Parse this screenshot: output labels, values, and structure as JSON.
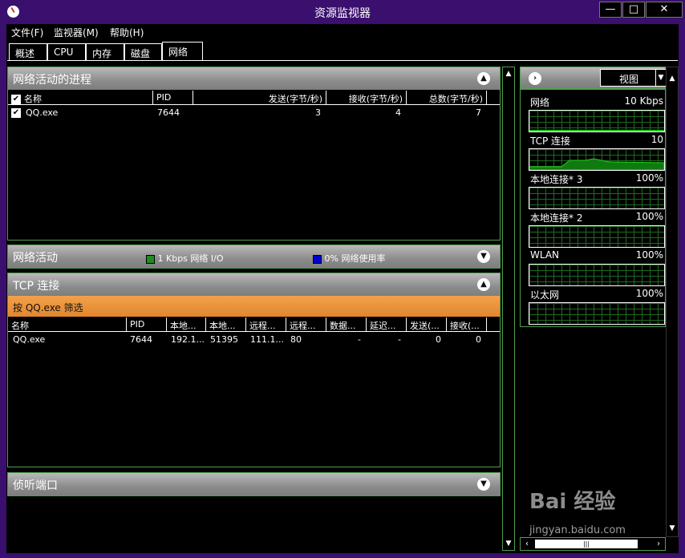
{
  "window": {
    "title": "资源监视器"
  },
  "title_buttons": {
    "minimize": "—",
    "maximize": "□",
    "close": "✕"
  },
  "menu": [
    "文件(F)",
    "监视器(M)",
    "帮助(H)"
  ],
  "tabs": [
    "概述",
    "CPU",
    "内存",
    "磁盘",
    "网络"
  ],
  "processes": {
    "title": "网络活动的进程",
    "columns": [
      "名称",
      "PID",
      "发送(字节/秒)",
      "接收(字节/秒)",
      "总数(字节/秒)"
    ],
    "rows": [
      {
        "name": "QQ.exe",
        "pid": "7644",
        "send": "3",
        "recv": "4",
        "total": "7"
      }
    ]
  },
  "activity": {
    "title": "网络活动",
    "legend1": "1 Kbps 网络 I/O",
    "legend2": "0% 网络使用率",
    "legend1_color": "#1e8c1e",
    "legend2_color": "#0000cc"
  },
  "tcp": {
    "title": "TCP 连接",
    "filter": "按 QQ.exe 筛选",
    "columns": [
      "名称",
      "PID",
      "本地...",
      "本地...",
      "远程...",
      "远程...",
      "数据...",
      "延迟...",
      "发送(...",
      "接收(..."
    ],
    "rows": [
      {
        "name": "QQ.exe",
        "pid": "7644",
        "local_addr": "192.1...",
        "local_port": "51395",
        "remote_addr": "111.1...",
        "remote_port": "80",
        "packet_loss": "-",
        "latency": "-",
        "send": "0",
        "recv": "0"
      }
    ]
  },
  "listening": {
    "title": "侦听端口"
  },
  "right_pane": {
    "view_label": "视图",
    "graphs": [
      {
        "label": "网络",
        "value": "10 Kbps"
      },
      {
        "label": "TCP 连接",
        "value": "10"
      },
      {
        "label": "本地连接* 3",
        "value": "100%"
      },
      {
        "label": "本地连接* 2",
        "value": "100%"
      },
      {
        "label": "WLAN",
        "value": "100%"
      },
      {
        "label": "以太网",
        "value": "100%"
      }
    ]
  },
  "colors": {
    "window_frame": "#3a0f6e",
    "panel_border": "#4e9e4e",
    "filter_bar": "#e8933a",
    "graph_line": "#22cc22"
  },
  "watermark": {
    "brand": "Bai 经验",
    "url": "jingyan.baidu.com"
  }
}
